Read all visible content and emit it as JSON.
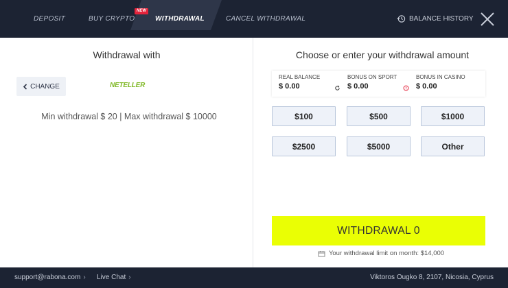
{
  "header": {
    "tabs": {
      "deposit": "DEPOSIT",
      "buy_crypto": "BUY CRYPTO",
      "withdrawal": "WITHDRAWAL",
      "cancel_withdrawal": "CANCEL WITHDRAWAL"
    },
    "new_badge": "NEW",
    "balance_history": "BALANCE HISTORY",
    "icons": {
      "balance_history": "history-icon",
      "close": "close-icon"
    }
  },
  "left": {
    "title": "Withdrawal with",
    "change_label": "CHANGE",
    "method_logo": "NETELLER",
    "limits_text": "Min withdrawal $ 20 | Max withdrawal $ 10000"
  },
  "right": {
    "title": "Choose or enter your withdrawal amount",
    "balances": [
      {
        "label": "REAL BALANCE",
        "value": "$ 0.00"
      },
      {
        "label": "BONUS ON SPORT",
        "value": "$ 0.00"
      },
      {
        "label": "BONUS IN CASINO",
        "value": "$ 0.00"
      }
    ],
    "amounts": [
      "$100",
      "$500",
      "$1000",
      "$2500",
      "$5000",
      "Other"
    ],
    "withdraw_button": "WITHDRAWAL 0",
    "limit_note": "Your withdrawal limit on month: $14,000"
  },
  "footer": {
    "support": "support@rabona.com",
    "live_chat": "Live Chat",
    "address": "Viktoros Ougko 8, 2107, Nicosia, Cyprus"
  },
  "colors": {
    "header_bg": "#1c2333",
    "accent_button": "#eaff04",
    "new_badge": "#e4233b",
    "neteller_green": "#83ba2b"
  }
}
